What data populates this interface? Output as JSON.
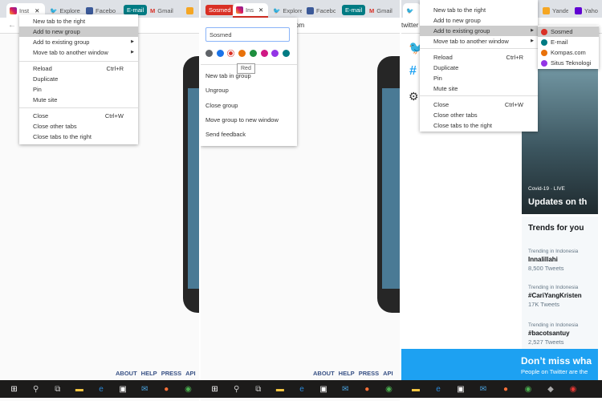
{
  "tabs": {
    "instagram": "Inst",
    "instagram_short": "Ins",
    "explore": "Explore",
    "facebook": "Facebo",
    "gmail": "Gmail",
    "yandex": "Yande",
    "yahoo": "Yaho",
    "twitter_url": "twitter",
    "url_fragment": "om"
  },
  "groups": {
    "email_chip": "E-mail",
    "sosmed_chip": "Sosmed"
  },
  "tab_menu": {
    "items": [
      "New tab to the right",
      "Add to new group",
      "Add to existing group",
      "Move tab to another window",
      "Reload",
      "Duplicate",
      "Pin",
      "Mute site",
      "Close",
      "Close other tabs",
      "Close tabs to the right"
    ],
    "shortcuts": {
      "reload": "Ctrl+R",
      "close": "Ctrl+W"
    }
  },
  "group_editor": {
    "name_value": "Sosmed",
    "colors": [
      "#5f6368",
      "#1a73e8",
      "#d93025",
      "#e8710a",
      "#1e8e3e",
      "#d01884",
      "#9334e6",
      "#007b83"
    ],
    "selected_color": "Red",
    "tooltip": "Red",
    "items": [
      "New tab in group",
      "Ungroup",
      "Close group",
      "Move group to new window",
      "Send feedback"
    ]
  },
  "existing_groups": [
    {
      "name": "Sosmed",
      "color": "#d93025"
    },
    {
      "name": "E-mail",
      "color": "#007b83"
    },
    {
      "name": "Kompas.com",
      "color": "#e8710a"
    },
    {
      "name": "Situs Teknologi",
      "color": "#9334e6"
    }
  ],
  "footer": [
    "ABOUT",
    "HELP",
    "PRESS",
    "API"
  ],
  "twitter": {
    "news_label": "Covid-19 · LIVE",
    "news_title": "Updates on th",
    "trends_title": "Trends for you",
    "trends": [
      {
        "context": "Trending in Indonesia",
        "name": "Innalillahi",
        "count": "8,500 Tweets"
      },
      {
        "context": "Trending in Indonesia",
        "name": "#CariYangKristen",
        "count": "17K Tweets"
      },
      {
        "context": "Trending in Indonesia",
        "name": "#bacotsantuy",
        "count": "2,527 Tweets"
      }
    ],
    "banner_title": "Don’t miss wha",
    "banner_sub": "People on Twitter are the"
  },
  "colors": {
    "teal": "#007b83",
    "red": "#d93025",
    "twitter_blue": "#1da1f2"
  }
}
